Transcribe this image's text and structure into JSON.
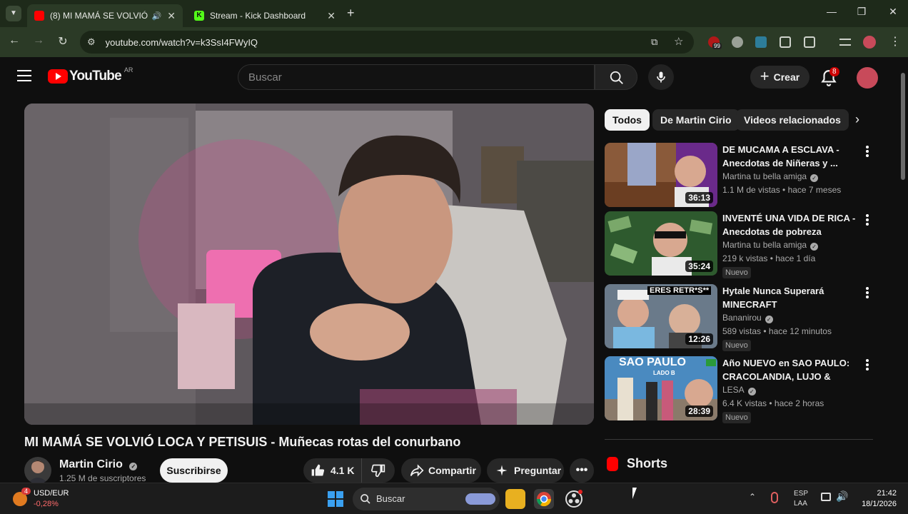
{
  "browser": {
    "tabs": [
      {
        "title": "(8) MI MAMÁ SE VOLVIÓ LOCA Y PETISUIS",
        "active": true
      },
      {
        "title": "Stream - Kick Dashboard",
        "active": false
      }
    ],
    "url": "youtube.com/watch?v=k3SsI4FWyIQ",
    "extension_badge": "99"
  },
  "yt_header": {
    "logo": "YouTube",
    "country": "AR",
    "search_placeholder": "Buscar",
    "create_label": "Crear",
    "notif_count": "8"
  },
  "video": {
    "title": "MI MAMÁ SE VOLVIÓ LOCA Y PETISUIS - Muñecas rotas del conurbano",
    "channel": "Martin Cirio",
    "subscribers": "1.25 M de suscriptores",
    "subscribe_label": "Suscribirse",
    "likes": "4.1 K",
    "share_label": "Compartir",
    "ask_label": "Preguntar"
  },
  "sidebar": {
    "chips": [
      "Todos",
      "De Martin Cirio",
      "Videos relacionados"
    ],
    "videos": [
      {
        "title": "DE MUCAMA A ESCLAVA - Anecdotas de Niñeras y ...",
        "channel": "Martina tu bella amiga",
        "meta": "1.1 M de vistas • hace 7 meses",
        "duration": "36:13",
        "new": ""
      },
      {
        "title": "INVENTÉ UNA VIDA DE RICA - Anecdotas de pobreza",
        "channel": "Martina tu bella amiga",
        "meta": "219 k vistas • hace 1 día",
        "duration": "35:24",
        "new": "Nuevo"
      },
      {
        "title": "Hytale Nunca Superará MINECRAFT",
        "channel": "Bananirou",
        "meta": "589 vistas • hace 12 minutos",
        "duration": "12:26",
        "new": "Nuevo",
        "thumb_text": "ERES RETR*S**"
      },
      {
        "title": "Año NUEVO en SAO PAULO: CRACOLANDIA, LUJO & TRAN...",
        "channel": "LESA",
        "meta": "6.4 K vistas • hace 2 horas",
        "duration": "28:39",
        "new": "Nuevo",
        "thumb_text": "SAO PAULO",
        "thumb_sub": "LADO B"
      }
    ],
    "shorts_label": "Shorts"
  },
  "taskbar": {
    "widget_badge": "4",
    "widget_title": "USD/EUR",
    "widget_value": "-0,28%",
    "search_label": "Buscar",
    "lang": "ESP",
    "lang2": "LAA",
    "time": "21:42",
    "date": "18/1/2026"
  }
}
